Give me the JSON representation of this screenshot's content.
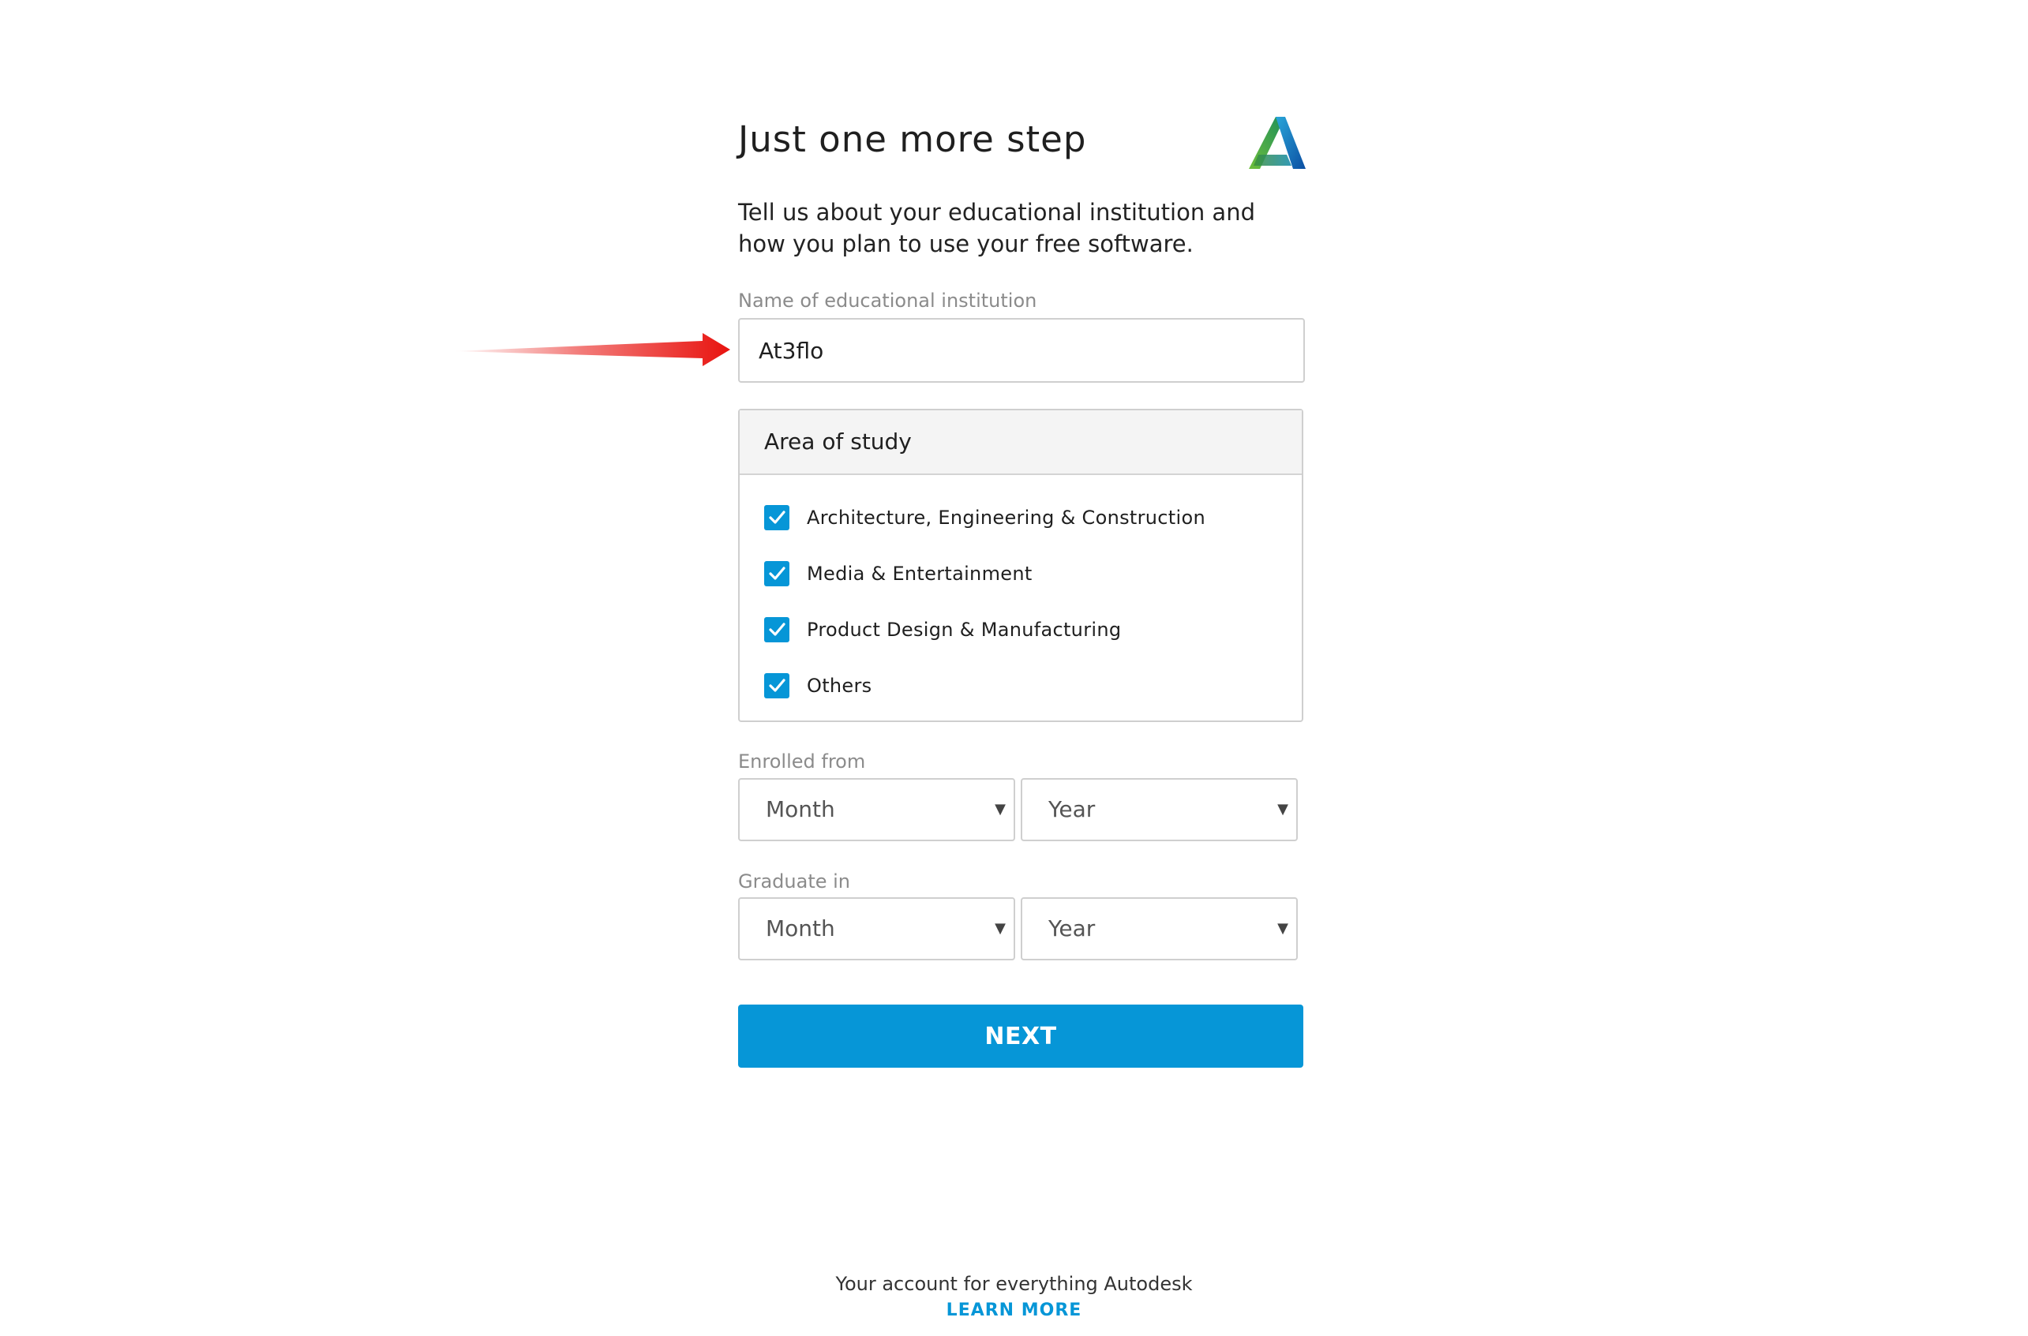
{
  "header": {
    "title": "Just one more step",
    "intro": "Tell us about your educational institution and how you plan to use your free software.",
    "logo_icon": "autodesk-logo-icon"
  },
  "institution": {
    "label": "Name of educational institution",
    "value": "At3flo"
  },
  "area_of_study": {
    "title": "Area of study",
    "options": [
      {
        "label": "Architecture, Engineering & Construction",
        "checked": true
      },
      {
        "label": "Media & Entertainment",
        "checked": true
      },
      {
        "label": "Product Design & Manufacturing",
        "checked": true
      },
      {
        "label": "Others",
        "checked": true
      }
    ]
  },
  "enrolled_from": {
    "label": "Enrolled from",
    "month": "Month",
    "year": "Year"
  },
  "graduate_in": {
    "label": "Graduate in",
    "month": "Month",
    "year": "Year"
  },
  "next_button": "NEXT",
  "footer": {
    "text": "Your account for everything Autodesk",
    "link": "LEARN MORE"
  },
  "colors": {
    "accent": "#0696d7",
    "annotation_arrow": "#e8130f"
  }
}
